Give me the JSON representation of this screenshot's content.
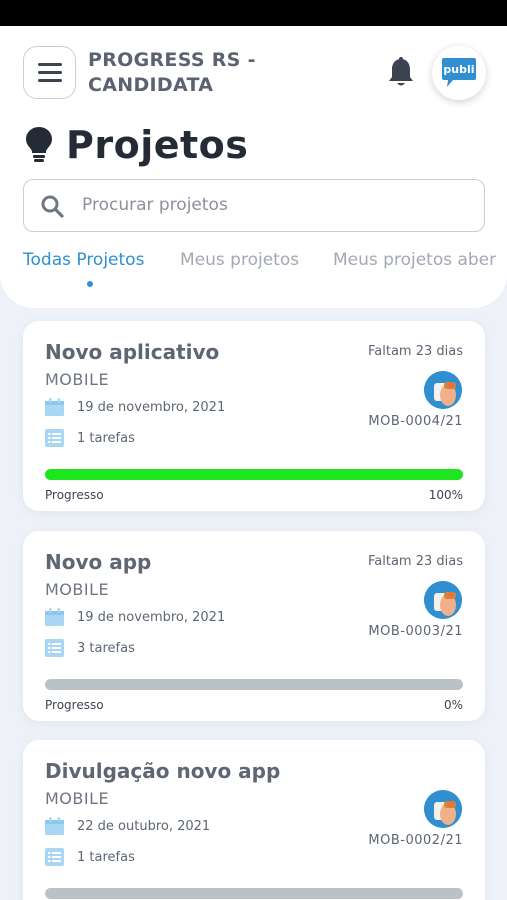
{
  "header": {
    "app_title_line1": "PROGRESS RS -",
    "app_title_line2": "CANDIDATA",
    "logo_text": "publ",
    "logo_text_tail": "i"
  },
  "page": {
    "title": "Projetos"
  },
  "search": {
    "placeholder": "Procurar projetos"
  },
  "tabs": [
    {
      "label": "Todas Projetos",
      "active": true
    },
    {
      "label": "Meus projetos",
      "active": false
    },
    {
      "label": "Meus projetos aber",
      "active": false
    }
  ],
  "projects": [
    {
      "name": "Novo aplicativo",
      "category": "MOBILE",
      "deadline": "Faltam 23 dias",
      "date": "19 de novembro, 2021",
      "tasks": "1 tarefas",
      "code": "MOB-0004/21",
      "progress_label": "Progresso",
      "progress_value": "100%",
      "progress_fraction": 1.0
    },
    {
      "name": "Novo app",
      "category": "MOBILE",
      "deadline": "Faltam 23 dias",
      "date": "19 de novembro, 2021",
      "tasks": "3 tarefas",
      "code": "MOB-0003/21",
      "progress_label": "Progresso",
      "progress_value": "0%",
      "progress_fraction": 0.0
    },
    {
      "name": "Divulgação novo app",
      "category": "MOBILE",
      "deadline": "",
      "date": "22 de outubro, 2021",
      "tasks": "1 tarefas",
      "code": "MOB-0002/21",
      "progress_label": "",
      "progress_value": "",
      "progress_fraction": 0.0
    }
  ],
  "colors": {
    "accent": "#2f8fd0",
    "progress_complete": "#1ee61e",
    "progress_track": "#b9c3c6",
    "icon_light_blue": "#a9d6f2"
  },
  "icons": {
    "menu": "hamburger-icon",
    "notifications": "bell-icon",
    "title": "lightbulb-icon",
    "search": "search-icon",
    "date": "calendar-icon",
    "tasks": "list-icon"
  }
}
